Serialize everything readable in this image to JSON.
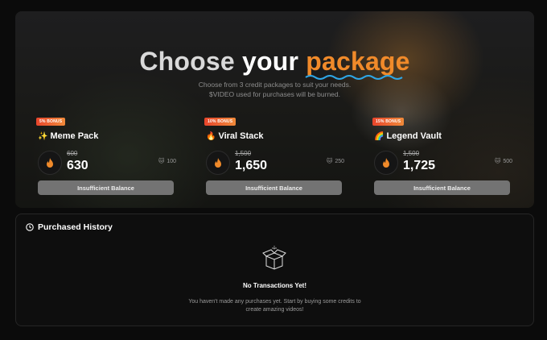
{
  "hero": {
    "title_part1": "Choose",
    "title_part2": "your",
    "title_part3": "package",
    "subtitle_line1": "Choose from 3 credit packages to suit your needs.",
    "subtitle_line2": "$VIDEO used for purchases will be burned."
  },
  "packages": [
    {
      "badge": "5% BONUS",
      "emoji": "✨",
      "name": "Meme Pack",
      "old_price": "600",
      "price": "630",
      "bonus": "100",
      "button": "Insufficient Balance"
    },
    {
      "badge": "10% BONUS",
      "emoji": "🔥",
      "name": "Viral Stack",
      "old_price": "1,500",
      "price": "1,650",
      "bonus": "250",
      "button": "Insufficient Balance"
    },
    {
      "badge": "15% BONUS",
      "emoji": "🌈",
      "name": "Legend Vault",
      "old_price": "1,500",
      "price": "1,725",
      "bonus": "500",
      "button": "Insufficient Balance"
    }
  ],
  "history": {
    "title": "Purchased History",
    "empty_title": "No Transactions Yet!",
    "empty_desc_line1": "You haven't made any purchases yet. Start by buying some credits to",
    "empty_desc_line2": "create amazing videos!"
  },
  "colors": {
    "accent": "#f08a2a",
    "badge_gradient_start": "#e8452c",
    "button_bg": "#737373",
    "page_bg": "#0b0b0b"
  },
  "icons": {
    "coin": "flame-coin-icon",
    "bonus": "cat-icon",
    "history": "clock-icon",
    "empty": "open-box-icon"
  }
}
